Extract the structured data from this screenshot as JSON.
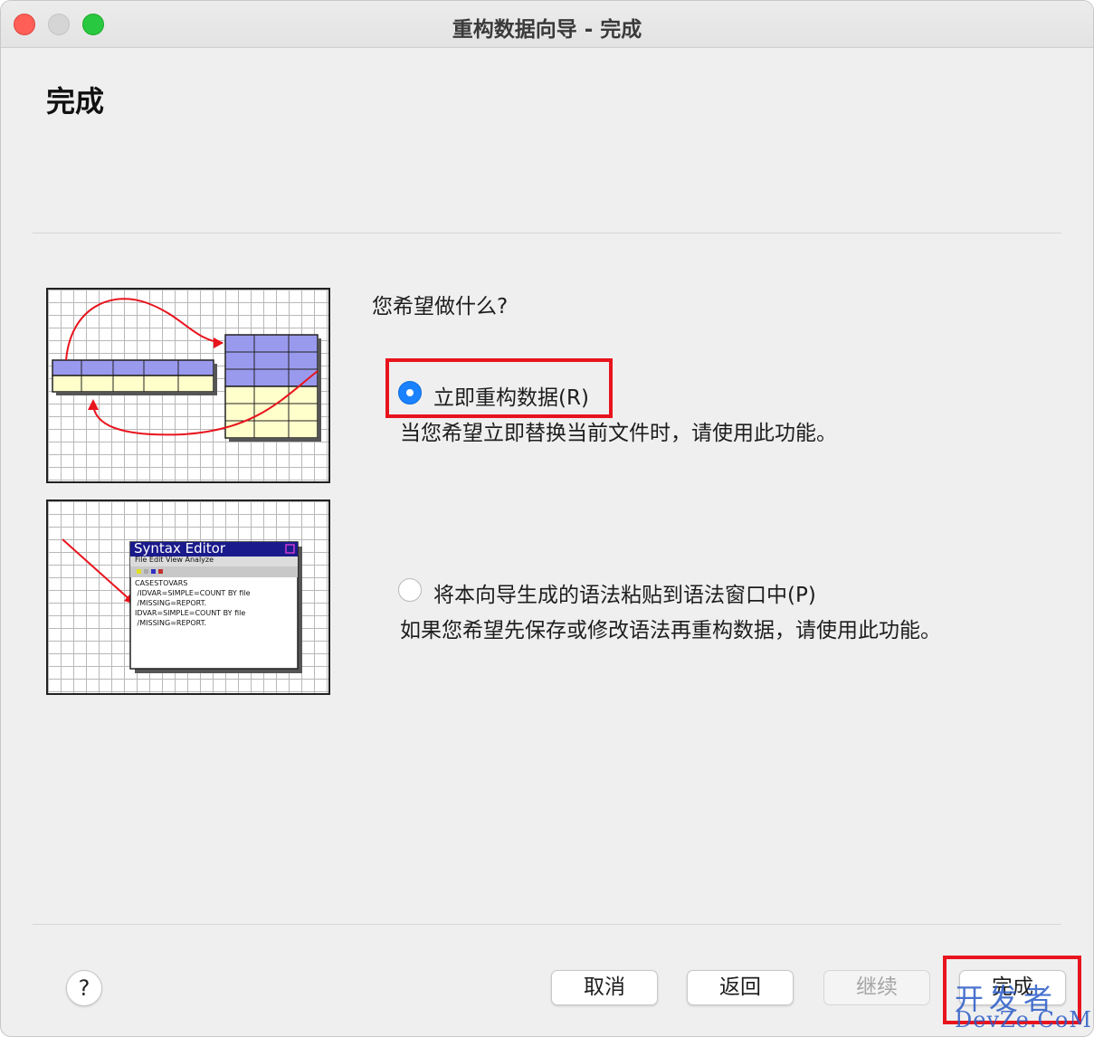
{
  "window": {
    "title": "重构数据向导 - 完成"
  },
  "page": {
    "heading": "完成",
    "question": "您希望做什么?"
  },
  "options": [
    {
      "label": "立即重构数据(R)",
      "description": "当您希望立即替换当前文件时，请使用此功能。",
      "selected": true
    },
    {
      "label": "将本向导生成的语法粘贴到语法窗口中(P)",
      "description": "如果您希望先保存或修改语法再重构数据，请使用此功能。",
      "selected": false
    }
  ],
  "illustration_syntax": {
    "window_title": "Syntax Editor",
    "menu": "File Edit View Analyze",
    "lines": [
      "CASESTOVARS",
      " /IDVAR=SIMPLE=COUNT BY file",
      " /MISSING=REPORT.",
      "IDVAR=SIMPLE=COUNT BY file",
      " /MISSING=REPORT."
    ]
  },
  "buttons": {
    "help": "?",
    "cancel": "取消",
    "back": "返回",
    "next": "继续",
    "finish": "完成"
  },
  "watermark": {
    "top": "开发者",
    "bottom": "DevZe.CoM"
  },
  "colors": {
    "accent": "#1a82ff",
    "highlight_box": "#e8141d",
    "table_header": "#9999ee",
    "table_cell": "#ffffcc",
    "arrow": "#e8141d"
  }
}
